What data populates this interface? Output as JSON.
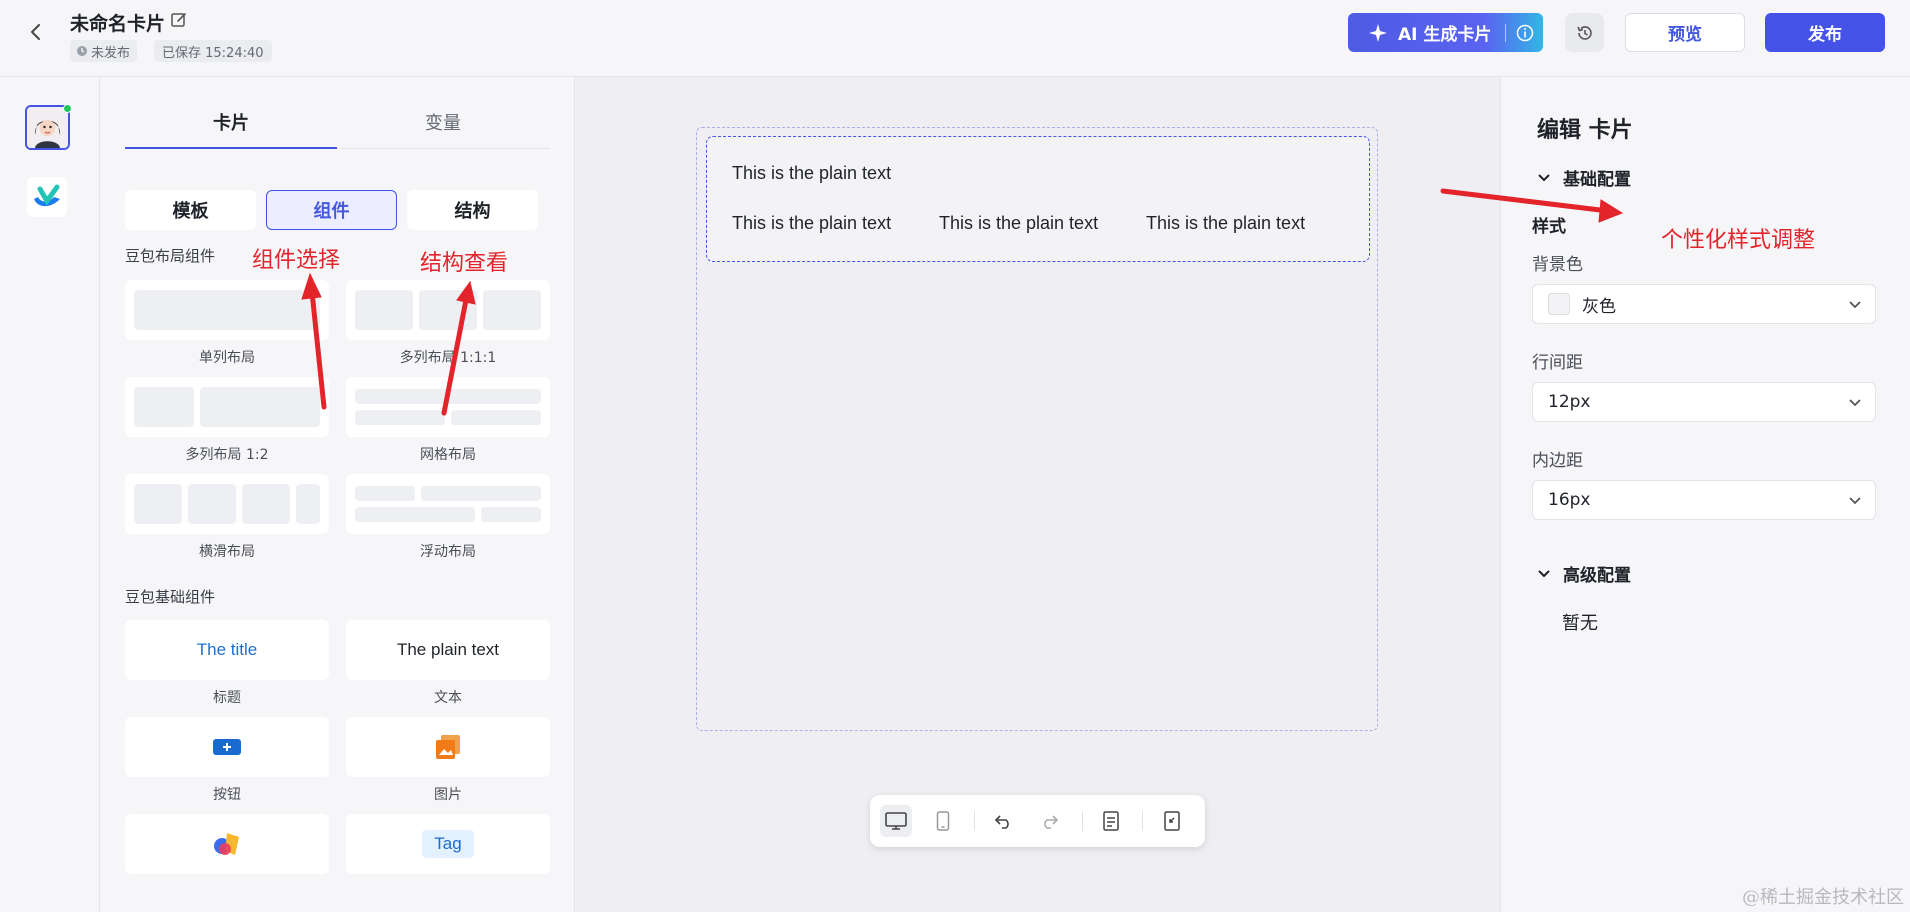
{
  "header": {
    "title": "未命名卡片",
    "status": "未发布",
    "saved": "已保存 15:24:40",
    "ai_button": "AI 生成卡片",
    "preview": "预览",
    "publish": "发布"
  },
  "panel": {
    "tabs": [
      "卡片",
      "变量"
    ],
    "segments": [
      "模板",
      "组件",
      "结构"
    ],
    "layout_section": "豆包布局组件",
    "layout_items": [
      "单列布局",
      "多列布局 1:1:1",
      "多列布局 1:2",
      "网格布局",
      "横滑布局",
      "浮动布局"
    ],
    "basic_section": "豆包基础组件",
    "basic_items": {
      "title_preview": "The title",
      "title_label": "标题",
      "text_preview": "The plain text",
      "text_label": "文本",
      "button_label": "按钮",
      "image_label": "图片",
      "tag_preview": "Tag"
    }
  },
  "canvas": {
    "card_texts": [
      "This is the plain text",
      "This is the plain text",
      "This is the plain text",
      "This is the plain text"
    ]
  },
  "props": {
    "title": "编辑 卡片",
    "basic_group": "基础配置",
    "style_label": "样式",
    "bg_label": "背景色",
    "bg_value": "灰色",
    "line_label": "行间距",
    "line_value": "12px",
    "padding_label": "内边距",
    "padding_value": "16px",
    "advanced_group": "高级配置",
    "advanced_empty": "暂无"
  },
  "annotations": {
    "component_select": "组件选择",
    "structure_view": "结构查看",
    "style_adjust": "个性化样式调整"
  },
  "watermark": "@稀土掘金技术社区",
  "colors": {
    "accent": "#4452e8",
    "annotation": "#e3242b",
    "status_online": "#22c55e"
  }
}
